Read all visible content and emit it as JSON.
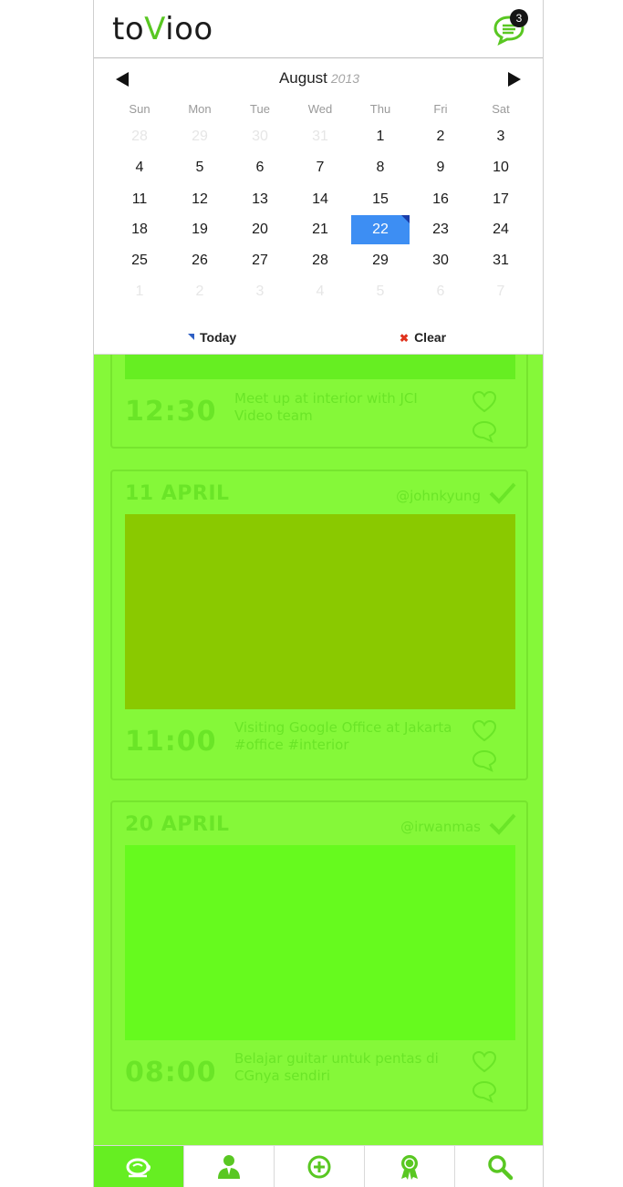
{
  "app": {
    "logo_prefix": "to",
    "logo_accent": "V",
    "logo_suffix": "ioo",
    "notification_count": "3",
    "accent_color": "#59c722"
  },
  "calendar": {
    "month": "August",
    "year": "2013",
    "weekdays": [
      "Sun",
      "Mon",
      "Tue",
      "Wed",
      "Thu",
      "Fri",
      "Sat"
    ],
    "weeks": [
      [
        "28",
        "29",
        "30",
        "31",
        "1",
        "2",
        "3"
      ],
      [
        "4",
        "5",
        "6",
        "7",
        "8",
        "9",
        "10"
      ],
      [
        "11",
        "12",
        "13",
        "14",
        "15",
        "16",
        "17"
      ],
      [
        "18",
        "19",
        "20",
        "21",
        "22",
        "23",
        "24"
      ],
      [
        "25",
        "26",
        "27",
        "28",
        "29",
        "30",
        "31"
      ],
      [
        "1",
        "2",
        "3",
        "4",
        "5",
        "6",
        "7"
      ]
    ],
    "selected_day": "22",
    "selected_color": "#3d8ef3",
    "today_label": "Today",
    "clear_label": "Clear"
  },
  "feed": {
    "background_color": "#85f839",
    "cards": [
      {
        "date": "",
        "user": "",
        "image_color": "#66ee22",
        "time": "12:30",
        "description": "Meet up at interior with JCI Video team"
      },
      {
        "date": "11 APRIL",
        "user": "@johnkyung",
        "image_color": "#8ac900",
        "time": "11:00",
        "description": "Visiting Google Office at Jakarta #office #interior"
      },
      {
        "date": "20 APRIL",
        "user": "@irwanmas",
        "image_color": "#66fa1e",
        "time": "08:00",
        "description": "Belajar guitar untuk pentas di CGnya sendiri"
      }
    ]
  },
  "bottom_nav": {
    "items": [
      {
        "icon": "coffee-cup-icon",
        "active": true
      },
      {
        "icon": "person-icon",
        "active": false
      },
      {
        "icon": "plus-circle-icon",
        "active": false
      },
      {
        "icon": "award-ribbon-icon",
        "active": false
      },
      {
        "icon": "search-icon",
        "active": false
      }
    ]
  }
}
